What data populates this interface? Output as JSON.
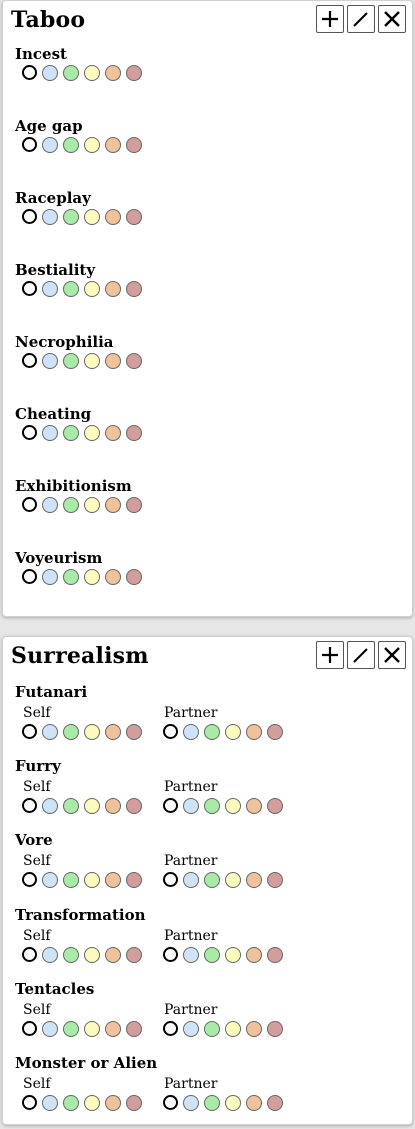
{
  "colors": {
    "choice_fills": [
      "#ffffff",
      "#cfe3f7",
      "#a7eba6",
      "#fafbbd",
      "#f0c29c",
      "#d49d9d"
    ]
  },
  "choice_count": 6,
  "taboo": {
    "title": "Taboo",
    "items": [
      {
        "name": "Incest"
      },
      {
        "name": "Age gap"
      },
      {
        "name": "Raceplay"
      },
      {
        "name": "Bestiality"
      },
      {
        "name": "Necrophilia"
      },
      {
        "name": "Cheating"
      },
      {
        "name": "Exhibitionism"
      },
      {
        "name": "Voyeurism"
      }
    ]
  },
  "surrealism": {
    "title": "Surrealism",
    "self_label": "Self",
    "partner_label": "Partner",
    "items": [
      {
        "name": "Futanari"
      },
      {
        "name": "Furry"
      },
      {
        "name": "Vore"
      },
      {
        "name": "Transformation"
      },
      {
        "name": "Tentacles"
      },
      {
        "name": "Monster or Alien"
      }
    ]
  },
  "toolbar": {
    "icons": [
      "plus-icon",
      "pencil-icon",
      "close-icon"
    ]
  }
}
